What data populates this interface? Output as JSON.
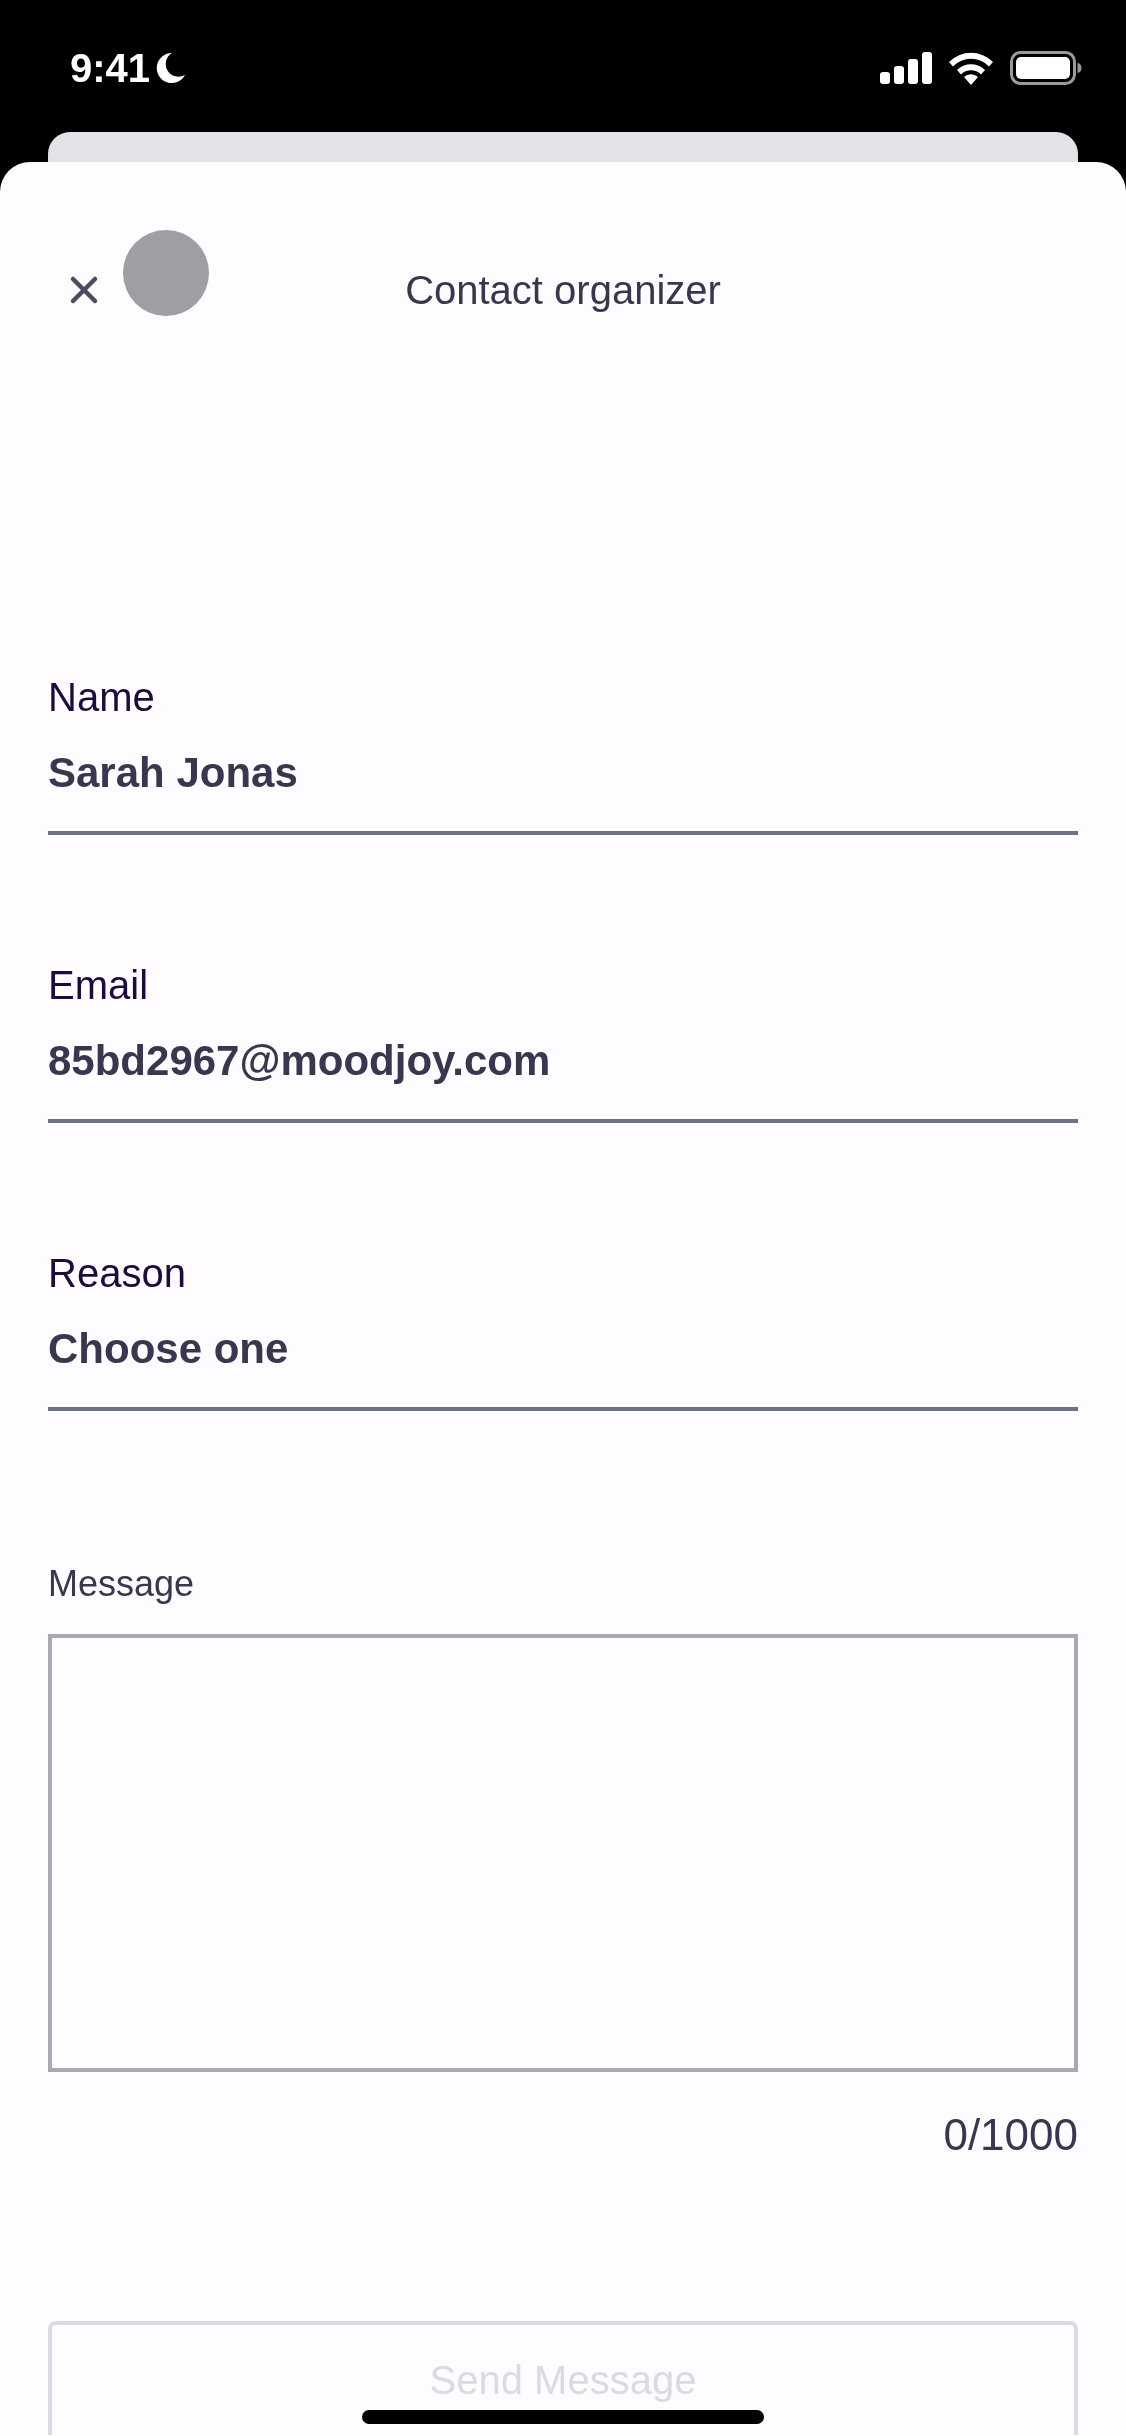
{
  "status_bar": {
    "time": "9:41"
  },
  "header": {
    "title": "Contact organizer"
  },
  "fields": [
    {
      "label": "Name",
      "value": "Sarah Jonas"
    },
    {
      "label": "Email",
      "value": "85bd2967@moodjoy.com"
    },
    {
      "label": "Reason",
      "value": "Choose one"
    }
  ],
  "message": {
    "label": "Message",
    "counter": "0/1000"
  },
  "send_button": {
    "label": "Send Message",
    "disabled": true
  }
}
